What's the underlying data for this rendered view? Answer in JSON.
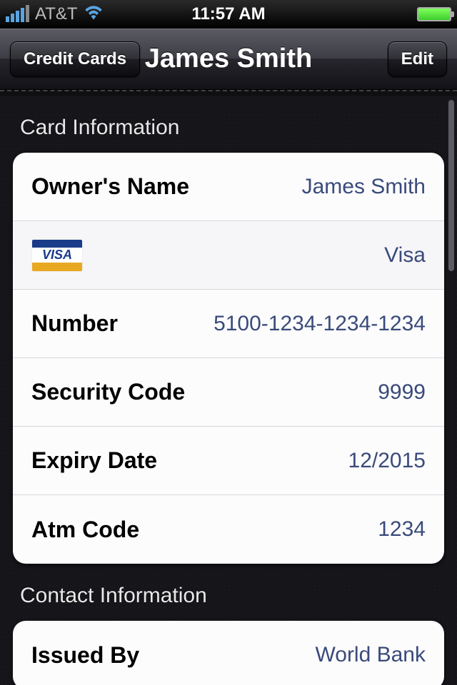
{
  "status": {
    "carrier": "AT&T",
    "time": "11:57 AM"
  },
  "nav": {
    "back_label": "Credit Cards",
    "title": "James Smith",
    "edit_label": "Edit"
  },
  "sections": {
    "card_info_header": "Card Information",
    "contact_info_header": "Contact Information"
  },
  "card_info": {
    "owner_label": "Owner's Name",
    "owner_value": "James Smith",
    "type_value": "Visa",
    "number_label": "Number",
    "number_value": "5100-1234-1234-1234",
    "security_label": "Security Code",
    "security_value": "9999",
    "expiry_label": "Expiry Date",
    "expiry_value": "12/2015",
    "atm_label": "Atm Code",
    "atm_value": "1234"
  },
  "contact_info": {
    "issued_by_label": "Issued By",
    "issued_by_value": "World Bank"
  }
}
